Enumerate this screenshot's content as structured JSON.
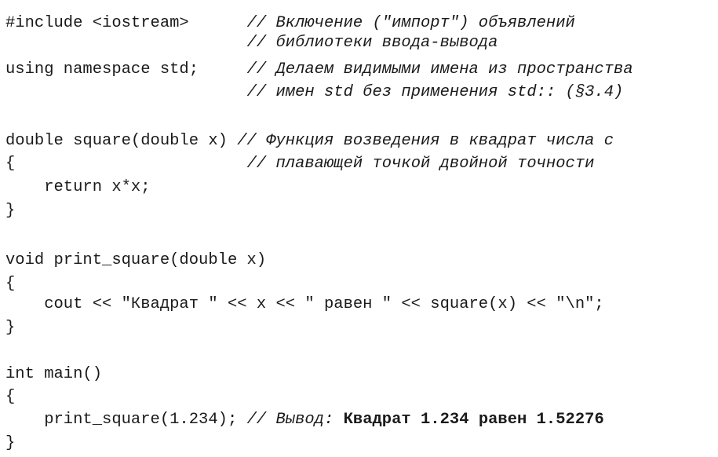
{
  "lines": [
    {
      "code": "#include <iostream>      ",
      "comment": "// Включение (\"импорт\") объявлений"
    },
    {
      "code": "                         ",
      "comment": "// библиотеки ввода-вывода"
    },
    {
      "code": "using namespace std;     ",
      "comment": "// Делаем видимыми имена из пространства"
    },
    {
      "code": "                         ",
      "comment": "// имен std без применения std:: (§3.4)"
    },
    {
      "code": "double square(double x) ",
      "comment": "// Функция возведения в квадрат числа с"
    },
    {
      "code": "{                        ",
      "comment": "// плавающей точкой двойной точности"
    },
    {
      "code": "    return x*x;",
      "comment": ""
    },
    {
      "code": "}",
      "comment": ""
    },
    {
      "code": "void print_square(double x)",
      "comment": ""
    },
    {
      "code": "{",
      "comment": ""
    },
    {
      "code": "    cout << \"Квадрат \" << x << \" равен \" << square(x) << \"\\n\";",
      "comment": ""
    },
    {
      "code": "}",
      "comment": ""
    },
    {
      "code": "int main()",
      "comment": ""
    },
    {
      "code": "{",
      "comment": ""
    },
    {
      "code": "    print_square(1.234); ",
      "comment": "// Вывод: ",
      "output": "Квадрат 1.234 равен 1.52276"
    },
    {
      "code": "}",
      "comment": ""
    }
  ]
}
